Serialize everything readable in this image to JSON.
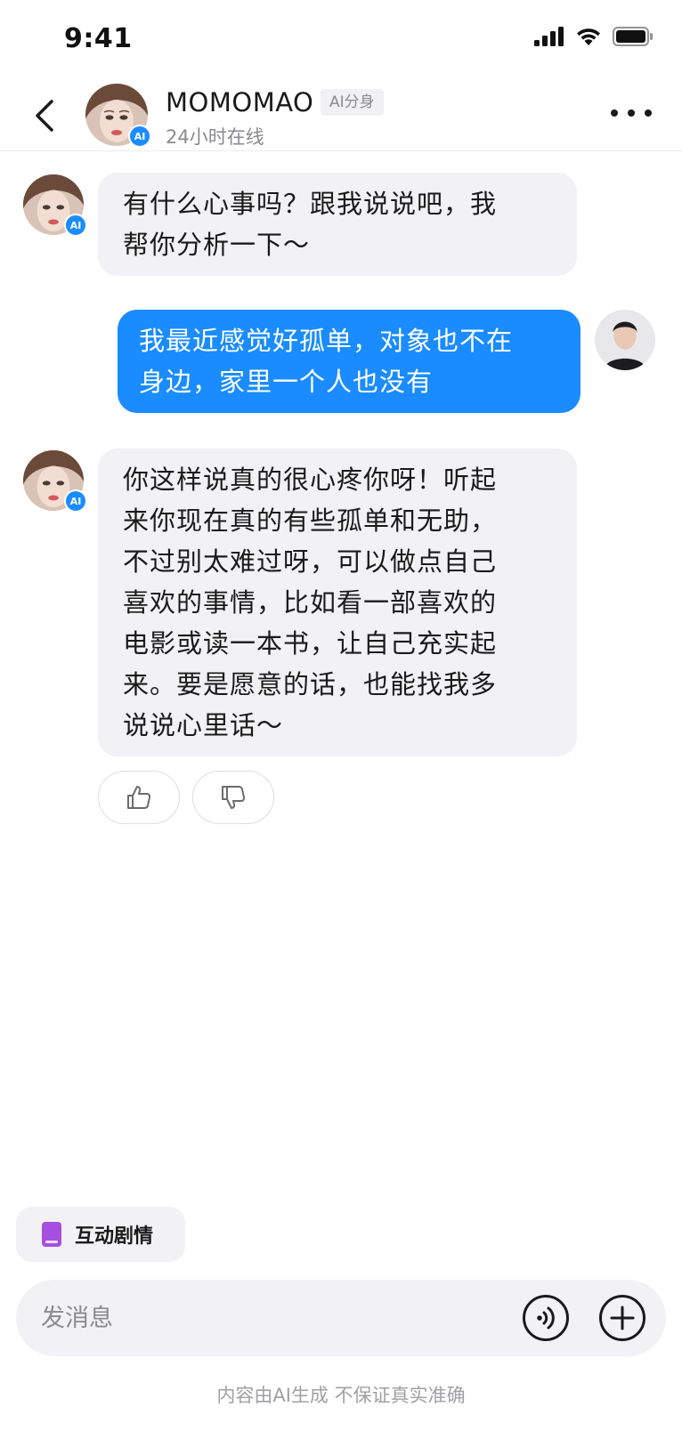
{
  "status_bar": {
    "time": "9:41"
  },
  "header": {
    "name": "MOMOMAO",
    "tag": "AI分身",
    "status": "24小时在线",
    "ai_badge": "AI"
  },
  "messages": [
    {
      "role": "ai",
      "lines": [
        "有什么心事吗？跟我说说吧，我",
        "帮你分析一下～"
      ]
    },
    {
      "role": "user",
      "lines": [
        "我最近感觉好孤单，对象也不在",
        "身边，家里一个人也没有"
      ]
    },
    {
      "role": "ai",
      "lines": [
        "你这样说真的很心疼你呀！听起",
        "来你现在真的有些孤单和无助，",
        "不过别太难过呀，可以做点自己",
        "喜欢的事情，比如看一部喜欢的",
        "电影或读一本书，让自己充实起",
        "来。要是愿意的话，也能找我多",
        "说说心里话～"
      ]
    }
  ],
  "chip": {
    "label": "互动剧情",
    "icon": "book-icon",
    "icon_color": "#a54ee0"
  },
  "input": {
    "placeholder": "发消息"
  },
  "disclaimer": "内容由AI生成 不保证真实准确",
  "colors": {
    "accent": "#1a8cff",
    "bubble_ai": "#f2f2f4",
    "text_secondary": "#8a8a8f"
  }
}
